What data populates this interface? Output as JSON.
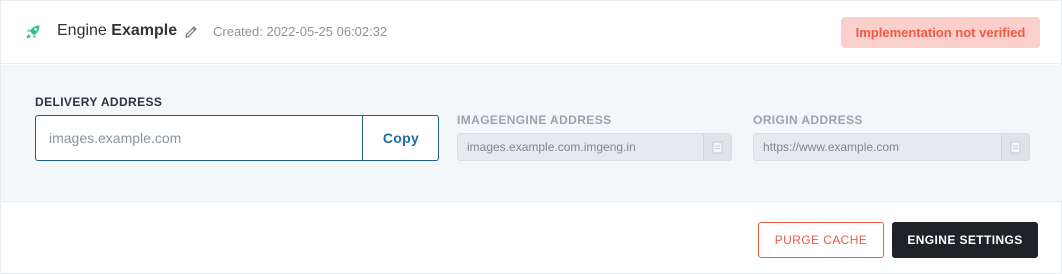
{
  "header": {
    "title_prefix": "Engine",
    "title_name": "Example",
    "created": "Created: 2022-05-25 06:02:32",
    "status_badge": "Implementation not verified"
  },
  "delivery": {
    "label": "DELIVERY ADDRESS",
    "value": "images.example.com",
    "copy_label": "Copy"
  },
  "imageengine": {
    "label": "IMAGEENGINE ADDRESS",
    "value": "images.example.com.imgeng.in"
  },
  "origin": {
    "label": "ORIGIN ADDRESS",
    "value": "https://www.example.com"
  },
  "actions": {
    "purge_label": "PURGE CACHE",
    "settings_label": "ENGINE SETTINGS"
  },
  "colors": {
    "accent": "#1a6fa3",
    "danger": "#ef5a45",
    "badge_bg": "#fbd0cc",
    "logo": "#2fbf87",
    "dark_button": "#1f2226"
  },
  "icons": {
    "logo": "rocket-icon",
    "edit": "pencil-icon",
    "copy": "clipboard-icon"
  }
}
